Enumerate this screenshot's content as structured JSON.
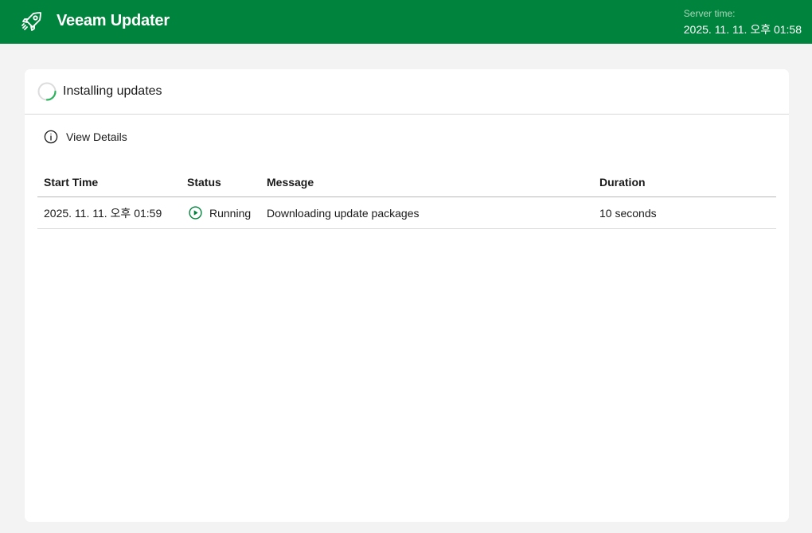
{
  "header": {
    "app_title": "Veeam Updater",
    "logo_icon": "rocket-icon",
    "server_time_label": "Server time:",
    "server_time_value": "2025. 11. 11. 오후 01:58"
  },
  "card": {
    "title": "Installing updates",
    "title_icon": "spinner-icon",
    "details_link": {
      "label": "View Details",
      "icon": "info-icon"
    }
  },
  "table": {
    "columns": [
      "Start Time",
      "Status",
      "Message",
      "Duration"
    ],
    "rows": [
      {
        "start_time": "2025. 11. 11. 오후 01:59",
        "status": "Running",
        "status_icon": "play-circle-icon",
        "message": "Downloading update packages",
        "duration": "10 seconds"
      }
    ]
  },
  "colors": {
    "brand_green": "#00843d",
    "accent_green": "#2db35d",
    "background": "#f2f3f2"
  }
}
